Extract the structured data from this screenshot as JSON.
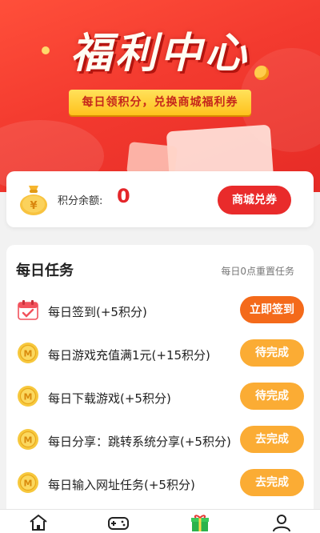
{
  "hero": {
    "title": "福利中心",
    "subtitle": "每日领积分，兑换商城福利券"
  },
  "points": {
    "label": "积分余额:",
    "value": "0",
    "shop_button": "商城兑券",
    "icon": "money-bag-icon"
  },
  "tasks": {
    "title": "每日任务",
    "reset_note": "每日0点重置任务",
    "items": [
      {
        "name": "每日签到(+5积分)",
        "action": "立即签到",
        "icon": "calendar-icon",
        "style": "primary"
      },
      {
        "name": "每日游戏充值满1元(+15积分)",
        "action": "待完成",
        "icon": "coin-icon",
        "style": "pending"
      },
      {
        "name": "每日下载游戏(+5积分)",
        "action": "待完成",
        "icon": "coin-icon",
        "style": "pending"
      },
      {
        "name": "每日分享：跳转系统分享(+5积分)",
        "action": "去完成",
        "icon": "coin-icon",
        "style": "pending"
      },
      {
        "name": "每日输入网址任务(+5积分)",
        "action": "去完成",
        "icon": "coin-icon",
        "style": "pending"
      }
    ]
  },
  "colors": {
    "accent_red": "#e92b2b",
    "primary_orange": "#f46a1a",
    "pending_orange": "#fbac34",
    "nav_active_green": "#2bb24c"
  },
  "nav": [
    {
      "icon": "home-icon",
      "active": false
    },
    {
      "icon": "gamepad-icon",
      "active": false
    },
    {
      "icon": "gift-icon",
      "active": true
    },
    {
      "icon": "user-icon",
      "active": false
    }
  ]
}
